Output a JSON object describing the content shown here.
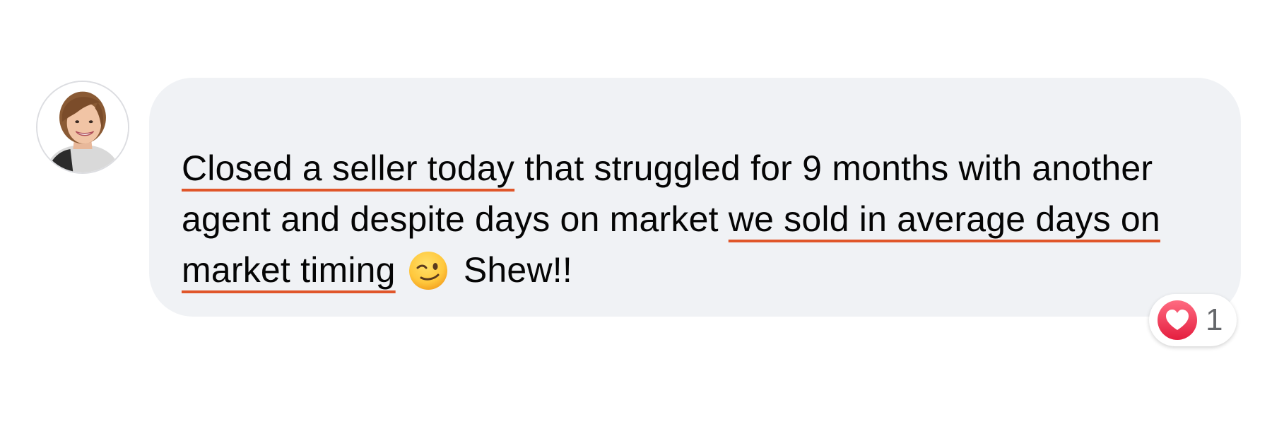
{
  "comment": {
    "segments": [
      {
        "text": "Closed a seller today",
        "highlight": true
      },
      {
        "text": " that struggled for 9 months with another agent and despite days on market ",
        "highlight": false
      },
      {
        "text": "we sold in average days on market timing",
        "highlight": true
      },
      {
        "text": " ",
        "highlight": false
      },
      {
        "text": " Shew!!",
        "highlight": false
      }
    ],
    "emoji": "winking-face-emoji",
    "highlight_color": "#e0562a",
    "bubble_color": "#f0f2f5"
  },
  "reactions": {
    "icon": "heart-icon",
    "count": "1",
    "heart_color": "#f0284a"
  },
  "avatar": {
    "icon": "user-avatar-photo"
  }
}
